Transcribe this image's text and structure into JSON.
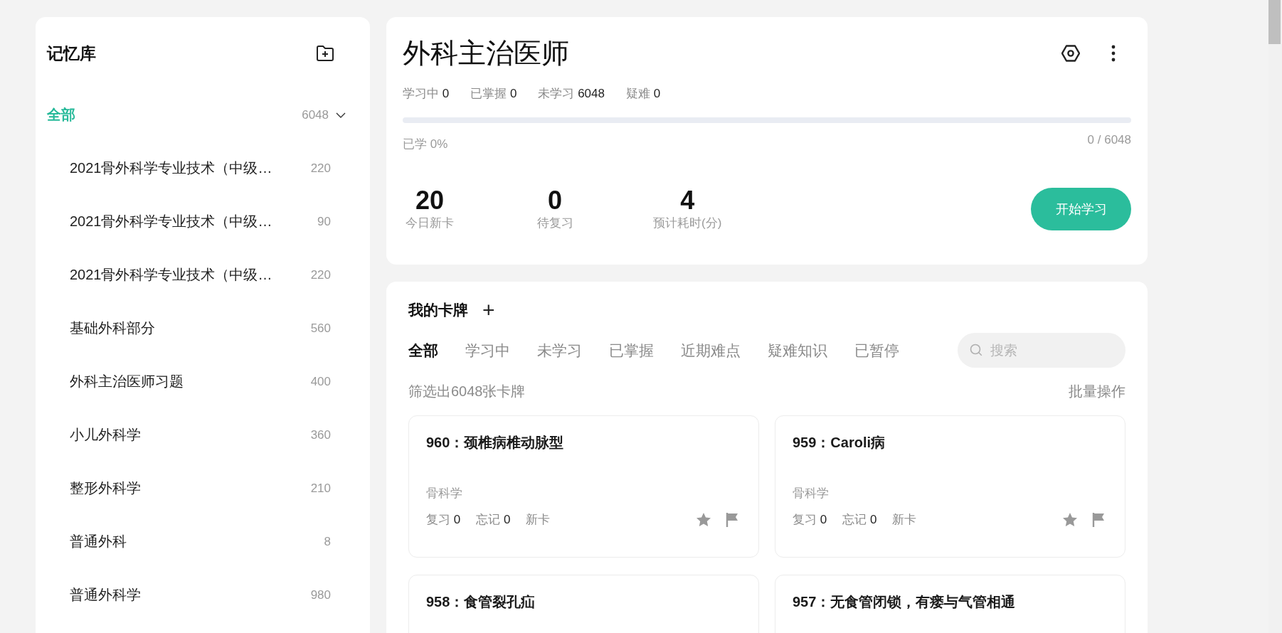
{
  "sidebar": {
    "title": "记忆库",
    "all": {
      "label": "全部",
      "count": "6048",
      "selected": true,
      "expanded": true
    },
    "items": [
      {
        "label": "2021骨外科学专业技术（中级…",
        "count": "220",
        "selected": false
      },
      {
        "label": "2021骨外科学专业技术（中级…",
        "count": "90",
        "selected": false
      },
      {
        "label": "2021骨外科学专业技术（中级…",
        "count": "220",
        "selected": false
      },
      {
        "label": "基础外科部分",
        "count": "560",
        "selected": false
      },
      {
        "label": "外科主治医师习题",
        "count": "400",
        "selected": false
      },
      {
        "label": "小儿外科学",
        "count": "360",
        "selected": false
      },
      {
        "label": "整形外科学",
        "count": "210",
        "selected": false
      },
      {
        "label": "普通外科",
        "count": "8",
        "selected": false
      },
      {
        "label": "普通外科学",
        "count": "980",
        "selected": false
      }
    ]
  },
  "deck": {
    "title": "外科主治医师",
    "stats": [
      {
        "label": "学习中",
        "value": "0"
      },
      {
        "label": "已掌握",
        "value": "0"
      },
      {
        "label": "未学习",
        "value": "6048"
      },
      {
        "label": "疑难",
        "value": "0"
      }
    ],
    "progress": {
      "level": 0,
      "label": "已学 0%",
      "reading": "0 / 6048"
    },
    "summary": [
      {
        "value": "20",
        "label": "今日新卡"
      },
      {
        "value": "0",
        "label": "待复习"
      },
      {
        "value": "4",
        "label": "预计耗时(分)"
      }
    ],
    "start_button": "开始学习"
  },
  "cards_panel": {
    "title": "我的卡牌",
    "add": "+",
    "tabs": [
      {
        "label": "全部",
        "selected": true
      },
      {
        "label": "学习中",
        "selected": false
      },
      {
        "label": "未学习",
        "selected": false
      },
      {
        "label": "已掌握",
        "selected": false
      },
      {
        "label": "近期难点",
        "selected": false
      },
      {
        "label": "疑难知识",
        "selected": false
      },
      {
        "label": "已暂停",
        "selected": false
      }
    ],
    "search": {
      "placeholder": "搜索"
    },
    "filter_summary": "筛选出6048张卡牌",
    "batch": "批量操作",
    "cards": [
      {
        "title": "960：颈椎病椎动脉型",
        "category": "骨科学",
        "review_label": "复习",
        "review": "0",
        "forget_label": "忘记",
        "forget": "0",
        "status": "新卡"
      },
      {
        "title": "959：Caroli病",
        "category": "骨科学",
        "review_label": "复习",
        "review": "0",
        "forget_label": "忘记",
        "forget": "0",
        "status": "新卡"
      },
      {
        "title": "958：食管裂孔疝"
      },
      {
        "title": "957：无食管闭锁，有瘘与气管相通"
      }
    ]
  }
}
